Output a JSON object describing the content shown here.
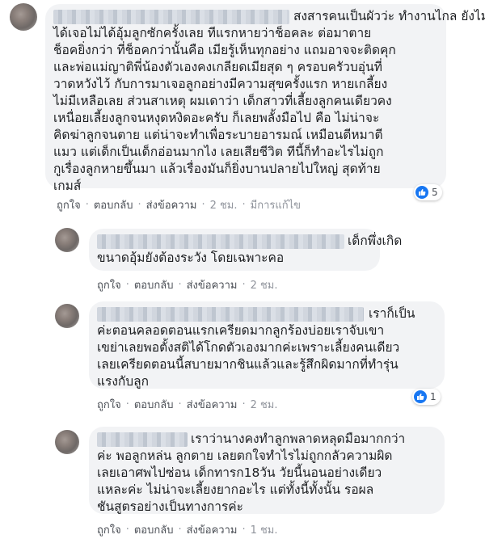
{
  "comments": [
    {
      "lines": [
        "สงสารคนเป็นผัวว่ะ ทำงานไกล ยังไม่",
        "ได้เจอไม่ได้อุ้มลูกซักครั้งเลย ทีแรกหายว่าช็อคละ ต่อมาตาย",
        "ช็อคยิ่งกว่า ที่ช็อคกว่านั้นคือ เมียรู้เห็นทุกอย่าง แถมอาจจะติดคุก",
        "และพ่อแม่ญาติพี่น้องตัวเองคงเกลียดเมียสุด ๆ ครอบครัวบอุ่นที่",
        "วาดหวังไว้ กับการมาเจอลูกอย่างมีความสุขครั้งแรก หายเกลี้ยง",
        "ไม่มีเหลือเลย ส่วนสาเหตุ ผมเดาว่า เด็กสาวที่เลี้ยงลูกคนเดียวคง",
        "เหนื่อยเลี้ยงลูกจนหงุดหงิดอะครับ ก็เลยพลั้งมือไป คือ ไม่น่าจะ",
        "คิดฆ่าลูกจนตาย แต่น่าจะทำเพื่อระบายอารมณ์ เหมือนตีหมาตี",
        "แมว แต่เด็กเป็นเด็กอ่อนมากไง เลยเสียชีวิต ทีนี้ก็ทำอะไรไม่ถูก",
        "กูเรื่องลูกหายขึ้นมา แล้วเรื่องมันก็ยิ่งบานปลายไปใหญ่ สุดท้าย",
        "เกมส์"
      ],
      "actions": {
        "like": "ถูกใจ",
        "reply": "ตอบกลับ",
        "message": "ส่งข้อความ",
        "time": "2 ชม.",
        "edited": "มีการแก้ไข"
      },
      "reactions": "5"
    },
    {
      "lines": [
        "เด็กพึ่งเกิด",
        "ขนาดอุ้มยังต้องระวัง โดยเฉพาะคอ"
      ],
      "actions": {
        "like": "ถูกใจ",
        "reply": "ตอบกลับ",
        "message": "ส่งข้อความ",
        "time": "2 ชม."
      }
    },
    {
      "lines": [
        "เราก็เป็น",
        "ค่ะตอนคลอดตอนแรกเครียดมากลูกร้องบ่อยเราจับเขา",
        "เขย่าเลยพอตั้งสติได้โกดตัวเองมากค่ะเพราะเลี้ยงคนเดียว",
        "เลยเครียดตอนนี้สบายมากชินแล้วและรู้สึกผิดมากที่ทำรุ่น",
        "แรงกับลูก"
      ],
      "actions": {
        "like": "ถูกใจ",
        "reply": "ตอบกลับ",
        "message": "ส่งข้อความ",
        "time": "2 ชม."
      },
      "reactions": "1"
    },
    {
      "lines": [
        "เราว่านางคงทำลูกพลาดหลุดมือมากกว่า",
        "ค่ะ พอลูกหล่น ลูกตาย เลยตกใจทำไรไม่ถูกกลัวความผิด",
        "เลยเอาศพไปซ่อน เด็กทารก18วัน วัยนี้นอนอย่างเดียว",
        "แหละค่ะ ไม่น่าจะเลี้ยงยากอะไร แต่ทั้งนี้ทั้งนั้น รอผล",
        "ชันสูตรอย่างเป็นทางการค่ะ"
      ],
      "actions": {
        "like": "ถูกใจ",
        "reply": "ตอบกลับ",
        "message": "ส่งข้อความ",
        "time": "1 ชม."
      }
    }
  ],
  "icons": {
    "reaction": "like-thumb-icon"
  },
  "colors": {
    "bubble": "#f2f3f5",
    "like_blue": "#1877f2",
    "action_text": "#4b4f56"
  }
}
